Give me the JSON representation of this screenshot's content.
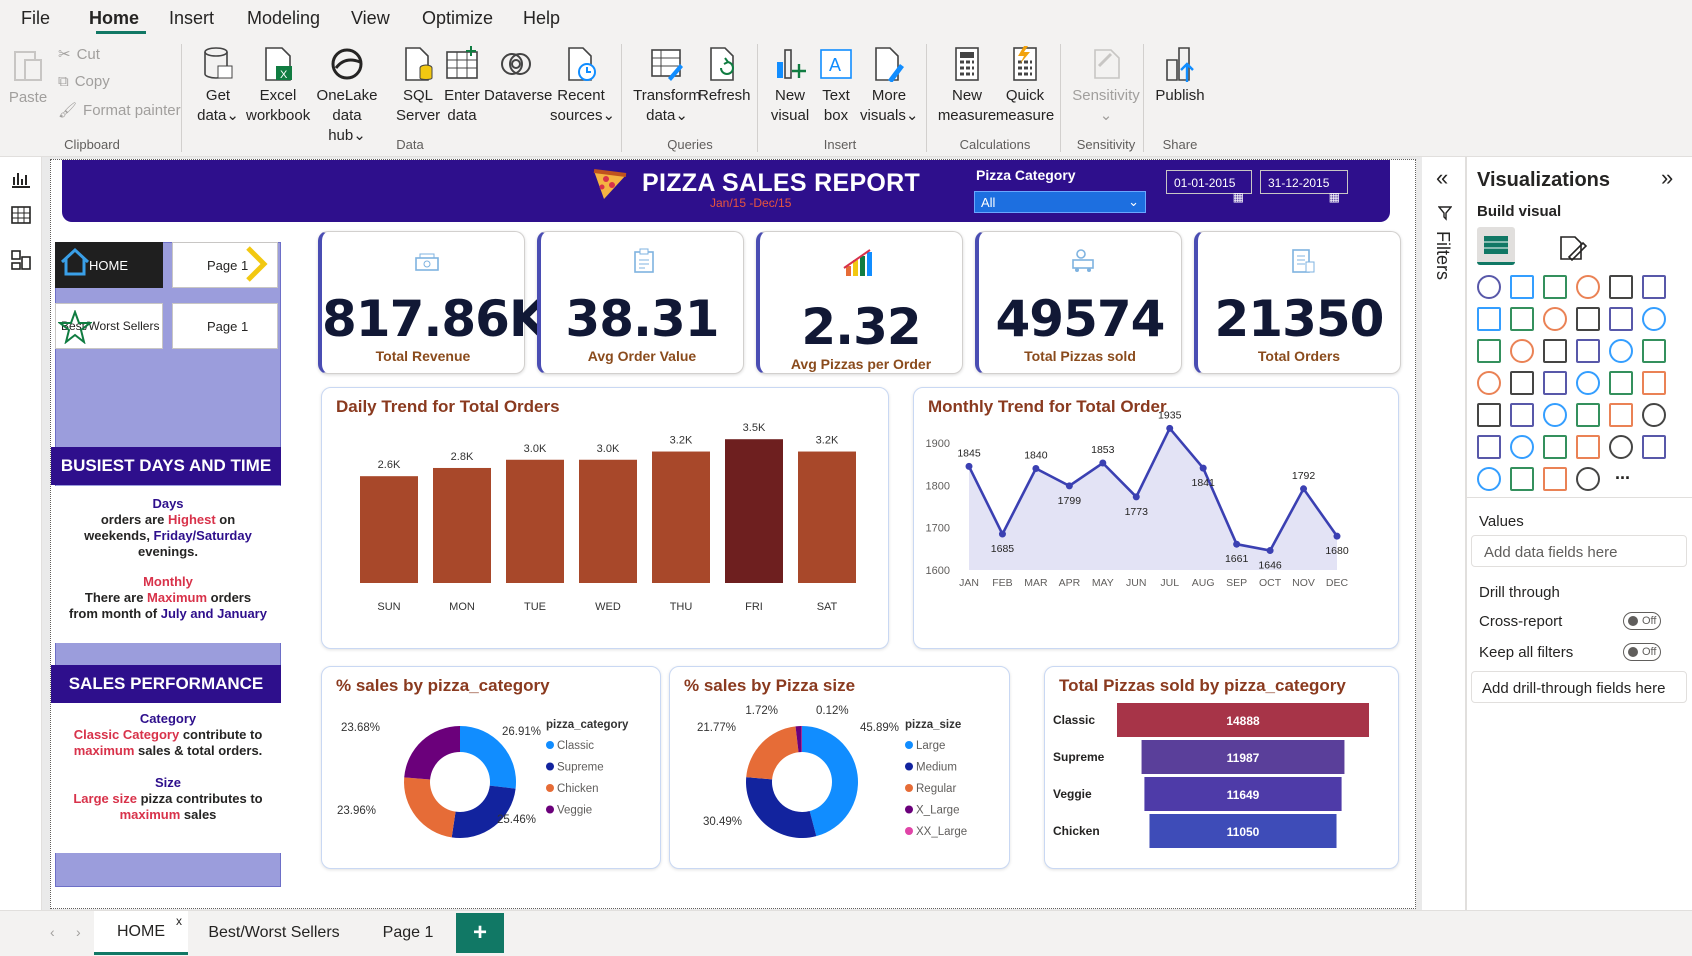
{
  "menu": {
    "file": "File",
    "home": "Home",
    "insert": "Insert",
    "modeling": "Modeling",
    "view": "View",
    "optimize": "Optimize",
    "help": "Help"
  },
  "ribbon": {
    "paste": "Paste",
    "cut": "Cut",
    "copy": "Copy",
    "format_painter": "Format painter",
    "clipboard": "Clipboard",
    "get_data_1": "Get",
    "get_data_2": "data",
    "excel_1": "Excel",
    "excel_2": "workbook",
    "onelake_1": "OneLake data",
    "onelake_2": "hub",
    "sql_1": "SQL",
    "sql_2": "Server",
    "enter_1": "Enter",
    "enter_2": "data",
    "dataverse": "Dataverse",
    "recent_1": "Recent",
    "recent_2": "sources",
    "data_group": "Data",
    "transform_1": "Transform",
    "transform_2": "data",
    "refresh": "Refresh",
    "queries_group": "Queries",
    "new_visual_1": "New",
    "new_visual_2": "visual",
    "text_box_1": "Text",
    "text_box_2": "box",
    "more_visuals_1": "More",
    "more_visuals_2": "visuals",
    "insert_group": "Insert",
    "new_measure_1": "New",
    "new_measure_2": "measure",
    "quick_measure_1": "Quick",
    "quick_measure_2": "measure",
    "calculations_group": "Calculations",
    "sensitivity": "Sensitivity",
    "sensitivity_group": "Sensitivity",
    "publish": "Publish",
    "share_group": "Share"
  },
  "report": {
    "title": "PIZZA SALES REPORT",
    "subtitle": "Jan/15 -Dec/15",
    "category_label": "Pizza Category",
    "category_value": "All",
    "date_from": "01-01-2015",
    "date_to": "31-12-2015"
  },
  "nav": {
    "home": "HOME",
    "page1a": "Page 1",
    "best_worst": "Best/Worst Sellers",
    "page1b": "Page 1"
  },
  "busiest": {
    "heading": "BUSIEST DAYS AND TIME",
    "days": "Days",
    "l1a": "orders are ",
    "l1b": "Highest",
    "l1c": " on",
    "l2a": "weekends, ",
    "l2b": "Friday/Saturday",
    "l3": "evenings.",
    "monthly": "Monthly",
    "m1a": "There are ",
    "m1b": "Maximum",
    "m1c": " orders",
    "m2a": "from month of ",
    "m2b": "July and January"
  },
  "sales_perf": {
    "heading": "SALES PERFORMANCE",
    "category": "Category",
    "c1a": "Classic Category",
    "c1b": " contribute to",
    "c2a": "maximum",
    "c2b": " sales & total orders.",
    "size": "Size",
    "s1a": "Large size",
    "s1b": " pizza contributes to",
    "s2a": "maximum",
    "s2b": " sales"
  },
  "kpis": [
    {
      "value": "817.86K",
      "label": "Total Revenue"
    },
    {
      "value": "38.31",
      "label": "Avg Order Value"
    },
    {
      "value": "2.32",
      "label": "Avg Pizzas per Order"
    },
    {
      "value": "49574",
      "label": "Total Pizzas sold"
    },
    {
      "value": "21350",
      "label": "Total Orders"
    }
  ],
  "colors": {
    "brand": "#2e0f8c",
    "accent": "#117865",
    "bar": "#a8482a",
    "bar_max": "#6e1f1f"
  },
  "chart_data": [
    {
      "type": "bar",
      "title": "Daily Trend for Total Orders",
      "categories": [
        "SUN",
        "MON",
        "TUE",
        "WED",
        "THU",
        "FRI",
        "SAT"
      ],
      "values": [
        2.6,
        2.8,
        3.0,
        3.0,
        3.2,
        3.5,
        3.2
      ],
      "labels": [
        "2.6K",
        "2.8K",
        "3.0K",
        "3.0K",
        "3.2K",
        "3.5K",
        "3.2K"
      ],
      "ylim": [
        0,
        3.6
      ]
    },
    {
      "type": "area",
      "title": "Monthly Trend for Total Order",
      "categories": [
        "JAN",
        "FEB",
        "MAR",
        "APR",
        "MAY",
        "JUN",
        "JUL",
        "AUG",
        "SEP",
        "OCT",
        "NOV",
        "DEC"
      ],
      "values": [
        1845,
        1685,
        1840,
        1799,
        1853,
        1773,
        1935,
        1841,
        1661,
        1646,
        1792,
        1680
      ],
      "yticks": [
        1900,
        1800,
        1700,
        1600
      ],
      "ylim": [
        1600,
        1950
      ]
    },
    {
      "type": "pie",
      "title": "% sales by pizza_category",
      "legend_title": "pizza_category",
      "slices": [
        {
          "name": "Classic",
          "value": 26.91,
          "label": "26.91%",
          "color": "#118dff"
        },
        {
          "name": "Supreme",
          "value": 25.46,
          "label": "25.46%",
          "color": "#12239e"
        },
        {
          "name": "Chicken",
          "value": 23.96,
          "label": "23.96%",
          "color": "#e66c37"
        },
        {
          "name": "Veggie",
          "value": 23.68,
          "label": "23.68%",
          "color": "#6b007b"
        }
      ]
    },
    {
      "type": "pie",
      "title": "% sales by Pizza size",
      "legend_title": "pizza_size",
      "slices": [
        {
          "name": "Large",
          "value": 45.89,
          "label": "45.89%",
          "color": "#118dff"
        },
        {
          "name": "Medium",
          "value": 30.49,
          "label": "30.49%",
          "color": "#12239e"
        },
        {
          "name": "Regular",
          "value": 21.77,
          "label": "21.77%",
          "color": "#e66c37"
        },
        {
          "name": "X_Large",
          "value": 1.72,
          "label": "1.72%",
          "color": "#6b007b"
        },
        {
          "name": "XX_Large",
          "value": 0.12,
          "label": "0.12%",
          "color": "#e044a7"
        }
      ]
    },
    {
      "type": "bar",
      "title": "Total Pizzas sold by pizza_category",
      "categories": [
        "Classic",
        "Supreme",
        "Veggie",
        "Chicken"
      ],
      "values": [
        14888,
        11987,
        11649,
        11050
      ],
      "labels": [
        "14888",
        "11987",
        "11649",
        "11050"
      ],
      "colors": [
        "#a73448",
        "#5a3f9a",
        "#4e3ba8",
        "#3e4cb8"
      ]
    }
  ],
  "viz": {
    "filters": "Filters",
    "title": "Visualizations",
    "build": "Build visual",
    "values": "Values",
    "add_data": "Add data fields here",
    "drill": "Drill through",
    "cross": "Cross-report",
    "keep": "Keep all filters",
    "off1": "Off",
    "off2": "Off",
    "add_drill": "Add drill-through fields here",
    "more": "..."
  },
  "tabs": {
    "home": "HOME",
    "best": "Best/Worst Sellers",
    "page1": "Page 1",
    "add": "+",
    "close": "x"
  }
}
